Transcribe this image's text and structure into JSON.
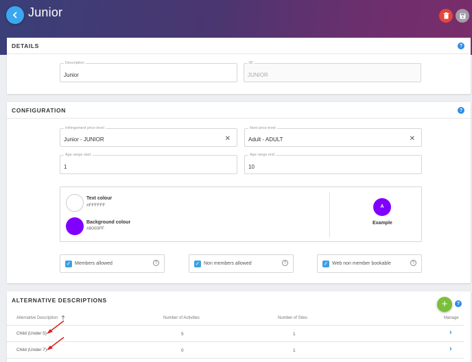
{
  "header": {
    "title": "Junior",
    "back_icon": "chevron-left-icon",
    "delete_icon": "trash-icon",
    "save_icon": "floppy-disk-icon",
    "colors": {
      "back": "#3aa7f0",
      "delete": "#e5463a",
      "save": "#a39aa8"
    }
  },
  "details": {
    "section_title": "DETAILS",
    "description": {
      "label": "Description",
      "value": "Junior"
    },
    "id": {
      "label": "ID",
      "value": "JUNIOR"
    }
  },
  "configuration": {
    "section_title": "CONFIGURATION",
    "infringement_price": {
      "label": "Infringement price level",
      "value": "Junior - JUNIOR"
    },
    "next_price": {
      "label": "Next price level",
      "value": "Adult - ADULT"
    },
    "age_start": {
      "label": "Age range start",
      "value": "1"
    },
    "age_end": {
      "label": "Age range end",
      "value": "10"
    },
    "text_colour": {
      "label": "Text colour",
      "hex": "#FFFFFF"
    },
    "background_colour": {
      "label": "Background colour",
      "hex": "#8000FF"
    },
    "example": {
      "letter": "A",
      "label": "Example"
    },
    "checkboxes": [
      {
        "label": "Members allowed",
        "checked": true
      },
      {
        "label": "Non members allowed",
        "checked": true
      },
      {
        "label": "Web non member bookable",
        "checked": true
      }
    ]
  },
  "alternative": {
    "section_title": "ALTERNATIVE DESCRIPTIONS",
    "columns": {
      "description": "Alternative Description",
      "activities": "Number of Activities",
      "sites": "Number of Sites",
      "manage": "Manage"
    },
    "rows": [
      {
        "description": "Child (Under 5)",
        "activities": "5",
        "sites": "1"
      },
      {
        "description": "Child (Under 7)",
        "activities": "0",
        "sites": "1"
      }
    ],
    "add_icon": "plus-icon"
  }
}
